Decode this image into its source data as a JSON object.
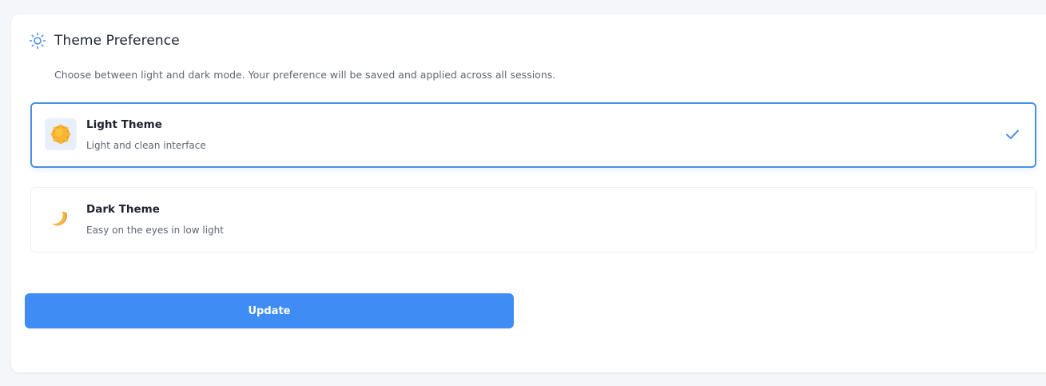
{
  "section": {
    "title": "Theme Preference",
    "icon": "sun-outline-icon",
    "description": "Choose between light and dark mode. Your preference will be saved and applied across all sessions."
  },
  "options": [
    {
      "title": "Light Theme",
      "subtitle": "Light and clean interface",
      "icon": "sun-emoji-icon",
      "selected": true
    },
    {
      "title": "Dark Theme",
      "subtitle": "Easy on the eyes in low light",
      "icon": "crescent-moon-emoji-icon",
      "selected": false
    }
  ],
  "actions": {
    "update_label": "Update"
  },
  "colors": {
    "accent": "#3f8cf5",
    "selected_border": "#4a8fe7",
    "page_background": "#f5f6f9"
  }
}
